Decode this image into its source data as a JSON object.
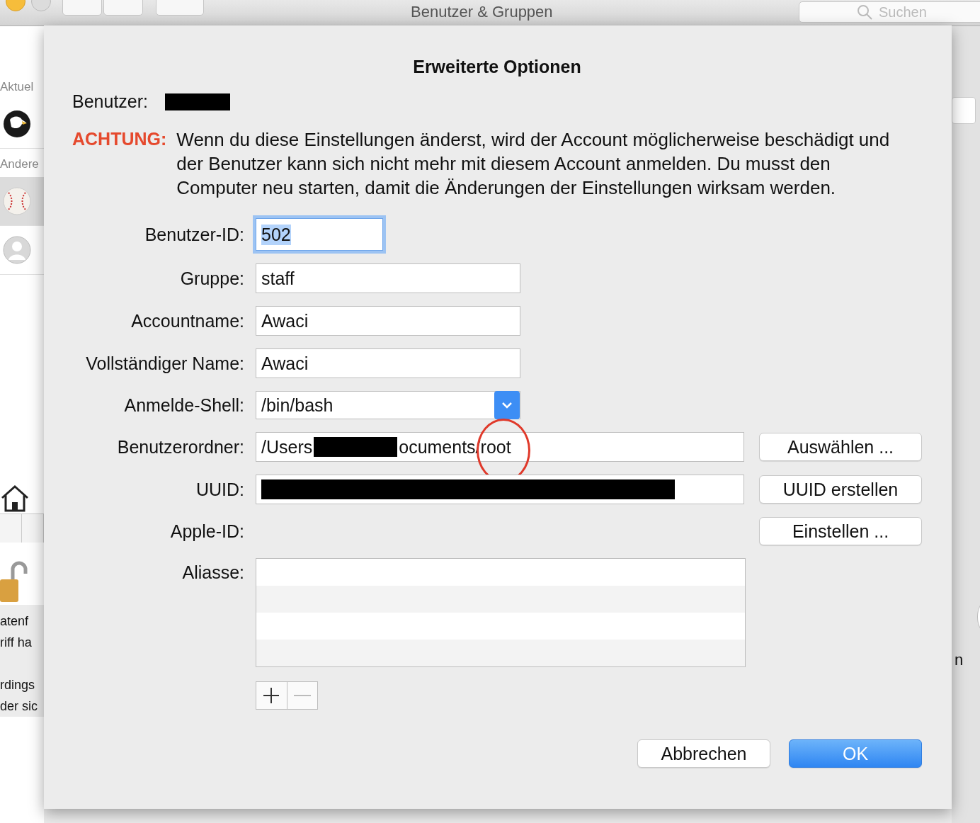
{
  "background_window": {
    "title": "Benutzer & Gruppen",
    "search": {
      "placeholder": "Suchen"
    },
    "sidebar": {
      "sections": [
        {
          "label": "Aktuel",
          "users": [
            {
              "kind": "eagle"
            }
          ]
        },
        {
          "label": "Andere",
          "users": [
            {
              "kind": "baseball",
              "selected": true
            },
            {
              "kind": "generic",
              "selected": false
            }
          ]
        }
      ],
      "text_fragments": [
        "atenf",
        "riff ha",
        "rdings",
        "der sic"
      ],
      "right_fragment": "n"
    }
  },
  "dialog": {
    "title": "Erweiterte Optionen",
    "user_label": "Benutzer:",
    "user_value_redacted": true,
    "warning": {
      "label": "ACHTUNG:",
      "text": "Wenn du diese Einstellungen änderst, wird der Account möglicherweise beschädigt und der Benutzer kann sich nicht mehr mit diesem Account anmelden. Du musst den Computer neu starten, damit die Änderungen der Einstellungen wirksam werden."
    },
    "fields": [
      {
        "kind": "text",
        "label": "Benutzer-ID:",
        "value": "502",
        "focused": true
      },
      {
        "kind": "text",
        "label": "Gruppe:",
        "value": "staff",
        "focused": false
      },
      {
        "kind": "text",
        "label": "Accountname:",
        "value": "Awaci",
        "focused": false
      },
      {
        "kind": "text",
        "label": "Vollständiger Name:",
        "value": "Awaci",
        "focused": false
      },
      {
        "kind": "popup",
        "label": "Anmelde-Shell:",
        "value": "/bin/bash"
      },
      {
        "kind": "path",
        "label": "Benutzerordner:",
        "value_start": "/Users",
        "value_end": "ocuments/root",
        "button": "Auswählen ..."
      },
      {
        "kind": "redacted",
        "label": "UUID:",
        "button": "UUID erstellen"
      },
      {
        "kind": "none",
        "label": "Apple-ID:",
        "button": "Einstellen ..."
      }
    ],
    "aliases": {
      "label": "Aliasse:"
    },
    "buttons": [
      {
        "label": "Abbrechen",
        "default": false
      },
      {
        "label": "OK",
        "default": true
      }
    ]
  }
}
